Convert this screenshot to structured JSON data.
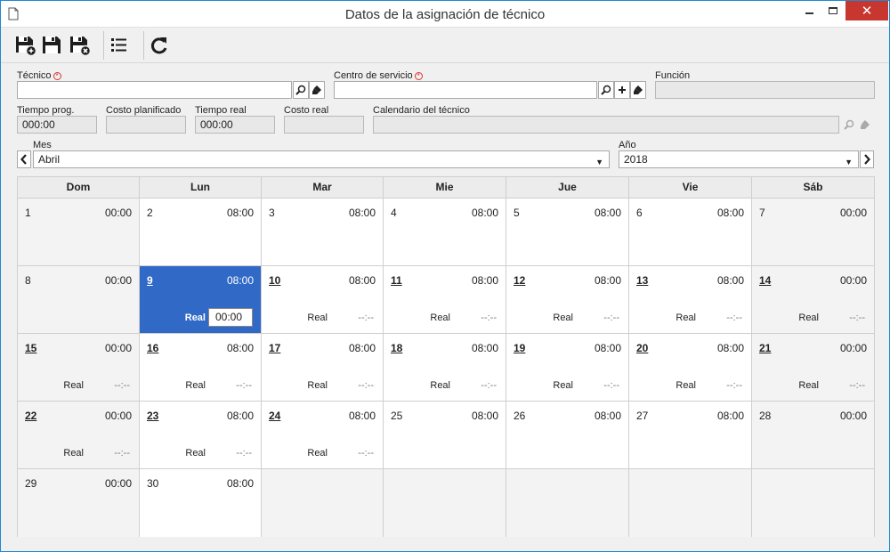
{
  "window": {
    "title": "Datos de la asignación de técnico"
  },
  "toolbar": {
    "buttons": [
      {
        "name": "save-new-button",
        "icon": "save-plus-icon"
      },
      {
        "name": "save-button",
        "icon": "save-icon"
      },
      {
        "name": "save-close-button",
        "icon": "save-close-icon"
      },
      {
        "name": "list-button",
        "icon": "list-icon"
      },
      {
        "name": "refresh-button",
        "icon": "refresh-icon"
      }
    ]
  },
  "form": {
    "tecnico": {
      "label": "Técnico",
      "value": ""
    },
    "centro": {
      "label": "Centro de servicio",
      "value": ""
    },
    "funcion": {
      "label": "Función",
      "value": ""
    },
    "tiempo_prog": {
      "label": "Tiempo prog.",
      "value": "000:00"
    },
    "costo_planificado": {
      "label": "Costo planificado",
      "value": ""
    },
    "tiempo_real": {
      "label": "Tiempo real",
      "value": "000:00"
    },
    "costo_real": {
      "label": "Costo real",
      "value": ""
    },
    "calendario": {
      "label": "Calendario del técnico",
      "value": ""
    },
    "mes": {
      "label": "Mes",
      "value": "Abril"
    },
    "anio": {
      "label": "Año",
      "value": "2018"
    }
  },
  "calendar": {
    "headers": [
      "Dom",
      "Lun",
      "Mar",
      "Mie",
      "Jue",
      "Vie",
      "Sáb"
    ],
    "real_label": "Real",
    "weeks": [
      [
        {
          "day": "1",
          "planned": "00:00",
          "weekend": true
        },
        {
          "day": "2",
          "planned": "08:00"
        },
        {
          "day": "3",
          "planned": "08:00"
        },
        {
          "day": "4",
          "planned": "08:00"
        },
        {
          "day": "5",
          "planned": "08:00"
        },
        {
          "day": "6",
          "planned": "08:00"
        },
        {
          "day": "7",
          "planned": "00:00",
          "weekend": true
        }
      ],
      [
        {
          "day": "8",
          "planned": "00:00",
          "weekend": true
        },
        {
          "day": "9",
          "planned": "08:00",
          "link": true,
          "selected": true,
          "real": "00:00"
        },
        {
          "day": "10",
          "planned": "08:00",
          "link": true,
          "real": "--:--"
        },
        {
          "day": "11",
          "planned": "08:00",
          "link": true,
          "real": "--:--"
        },
        {
          "day": "12",
          "planned": "08:00",
          "link": true,
          "real": "--:--"
        },
        {
          "day": "13",
          "planned": "08:00",
          "link": true,
          "real": "--:--"
        },
        {
          "day": "14",
          "planned": "00:00",
          "link": true,
          "weekend": true,
          "real": "--:--"
        }
      ],
      [
        {
          "day": "15",
          "planned": "00:00",
          "link": true,
          "weekend": true,
          "real": "--:--"
        },
        {
          "day": "16",
          "planned": "08:00",
          "link": true,
          "real": "--:--"
        },
        {
          "day": "17",
          "planned": "08:00",
          "link": true,
          "real": "--:--"
        },
        {
          "day": "18",
          "planned": "08:00",
          "link": true,
          "real": "--:--"
        },
        {
          "day": "19",
          "planned": "08:00",
          "link": true,
          "real": "--:--"
        },
        {
          "day": "20",
          "planned": "08:00",
          "link": true,
          "real": "--:--"
        },
        {
          "day": "21",
          "planned": "00:00",
          "link": true,
          "weekend": true,
          "real": "--:--"
        }
      ],
      [
        {
          "day": "22",
          "planned": "00:00",
          "link": true,
          "weekend": true,
          "real": "--:--"
        },
        {
          "day": "23",
          "planned": "08:00",
          "link": true,
          "real": "--:--"
        },
        {
          "day": "24",
          "planned": "08:00",
          "link": true,
          "real": "--:--"
        },
        {
          "day": "25",
          "planned": "08:00"
        },
        {
          "day": "26",
          "planned": "08:00"
        },
        {
          "day": "27",
          "planned": "08:00"
        },
        {
          "day": "28",
          "planned": "00:00",
          "weekend": true
        }
      ],
      [
        {
          "day": "29",
          "planned": "00:00",
          "weekend": true
        },
        {
          "day": "30",
          "planned": "08:00"
        },
        {
          "empty": true
        },
        {
          "empty": true
        },
        {
          "empty": true
        },
        {
          "empty": true
        },
        {
          "empty": true
        }
      ]
    ]
  }
}
